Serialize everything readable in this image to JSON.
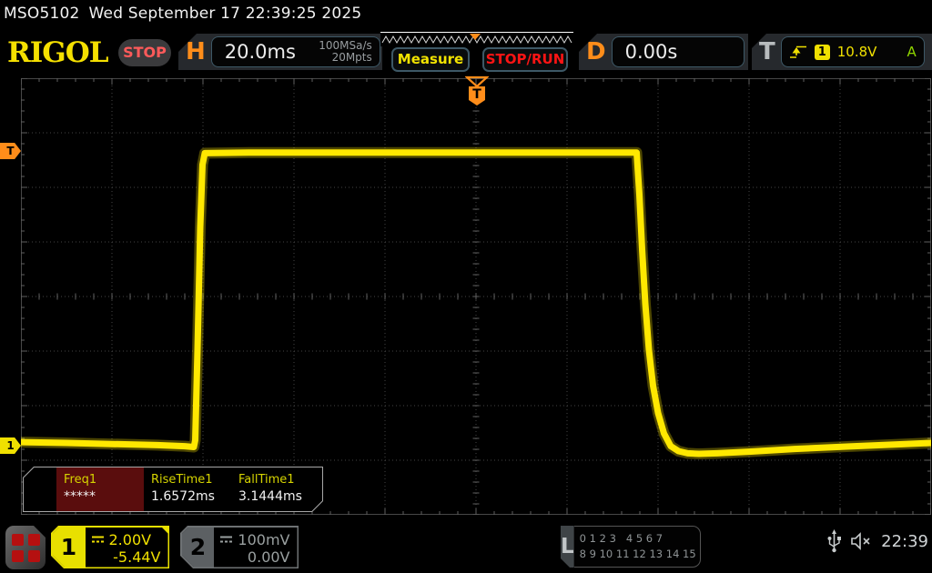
{
  "titlebar": {
    "model": "MSO5102",
    "datetime": "Wed September 17 22:39:25 2025"
  },
  "header": {
    "logo": "RIGOL",
    "acquisition_status": "STOP",
    "horizontal": {
      "label": "H",
      "timebase": "20.0ms",
      "sample_rate": "100MSa/s",
      "memory_depth": "20Mpts"
    },
    "measure_button_label": "Measure",
    "stop_run_button_label": "STOP/RUN",
    "delay": {
      "label": "D",
      "value": "0.00s"
    },
    "trigger": {
      "label": "T",
      "slope_icon": "rising-edge-icon",
      "source_channel": "1",
      "level": "10.8V",
      "sweep_mode": "A"
    }
  },
  "graticule": {
    "trigger_position_label": "T",
    "trigger_level_label": "T",
    "channel1_marker_label": "1"
  },
  "measurements": {
    "items": [
      {
        "label": "Freq1",
        "value": "*****",
        "highlighted": true
      },
      {
        "label": "RiseTime1",
        "value": "1.6572ms",
        "highlighted": false
      },
      {
        "label": "FallTime1",
        "value": "3.1444ms",
        "highlighted": false
      }
    ]
  },
  "bottom_bar": {
    "channel1": {
      "id": "1",
      "scale": "2.00V",
      "offset": "-5.44V"
    },
    "channel2": {
      "id": "2",
      "scale": "100mV",
      "offset": "0.00V"
    },
    "digital": {
      "label": "L",
      "row1": "0 1 2 3   4 5 6 7",
      "row2": "8 9 10 11 12 13 14 15"
    },
    "clock": "22:39"
  },
  "colors": {
    "accent_orange": "#ff8d1a",
    "channel1_yellow": "#f0e000",
    "trace_yellow": "#ffe800",
    "stop_red": "#ff1414",
    "trigger_mode_green": "#8fd400",
    "grid_line": "#454545",
    "measure_highlight_bg": "#5a0d0d"
  },
  "chart_data": {
    "type": "line",
    "title": "CH1 square pulse",
    "x_unit": "ms",
    "y_unit": "V",
    "x_divisions": 10,
    "y_divisions": 8,
    "timebase_per_div": "20.0ms",
    "volts_per_div": "2.00V",
    "x_range_ms": [
      -100,
      100
    ],
    "trigger_level_v": 10.8,
    "high_level_v": 10.74,
    "low_level_v": 0,
    "rise_time": "1.6572ms",
    "fall_time": "3.1444ms",
    "series": [
      {
        "name": "CH1",
        "color": "#ffe800",
        "points": [
          [
            -100,
            0.13
          ],
          [
            -90,
            0.1
          ],
          [
            -80,
            0.06
          ],
          [
            -70,
            0.02
          ],
          [
            -64,
            -0.02
          ],
          [
            -62.0,
            -0.05
          ],
          [
            -61.7,
            0.2
          ],
          [
            -61.2,
            3.5
          ],
          [
            -60.6,
            8.0
          ],
          [
            -60.1,
            10.3
          ],
          [
            -59.6,
            10.72
          ],
          [
            -50,
            10.74
          ],
          [
            -30,
            10.74
          ],
          [
            0,
            10.74
          ],
          [
            20,
            10.74
          ],
          [
            35.3,
            10.74
          ],
          [
            35.9,
            9.2
          ],
          [
            36.5,
            7.2
          ],
          [
            37.2,
            5.2
          ],
          [
            38.0,
            3.5
          ],
          [
            38.9,
            2.2
          ],
          [
            40.0,
            1.2
          ],
          [
            41.3,
            0.45
          ],
          [
            42.8,
            -0.02
          ],
          [
            44.5,
            -0.2
          ],
          [
            46.5,
            -0.28
          ],
          [
            49,
            -0.3
          ],
          [
            53,
            -0.28
          ],
          [
            60,
            -0.22
          ],
          [
            70,
            -0.12
          ],
          [
            82,
            -0.03
          ],
          [
            92,
            0.04
          ],
          [
            100,
            0.1
          ]
        ]
      }
    ]
  }
}
